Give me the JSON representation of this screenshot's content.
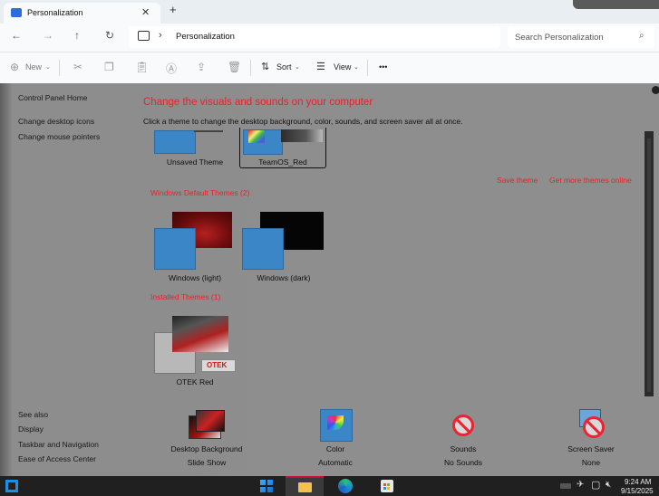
{
  "window": {
    "tab_title": "Personalization",
    "close_glyph": "✕",
    "newtab_glyph": "+"
  },
  "nav": {
    "back": "←",
    "forward": "→",
    "up": "↑",
    "refresh": "↻",
    "breadcrumb": "Personalization",
    "search_placeholder": "Search Personalization"
  },
  "commands": {
    "new": "New",
    "sort": "Sort",
    "view": "View",
    "more": "•••"
  },
  "sidebar": {
    "home": "Control Panel Home",
    "links": [
      "Change desktop icons",
      "Change mouse pointers"
    ],
    "see_also_title": "See also",
    "see_also": [
      "Display",
      "Taskbar and Navigation",
      "Ease of Access Center"
    ]
  },
  "main": {
    "heading": "Change the visuals and sounds on your computer",
    "subheading": "Click a theme to change the desktop background, color, sounds, and screen saver all at once.",
    "my_themes": [
      {
        "name": "Unsaved Theme"
      },
      {
        "name": "TeamOS_Red"
      }
    ],
    "save_theme": "Save theme",
    "get_more": "Get more themes online",
    "default_section": "Windows Default Themes (2)",
    "default_themes": [
      {
        "name": "Windows (light)"
      },
      {
        "name": "Windows (dark)"
      }
    ],
    "installed_section": "Installed Themes (1)",
    "installed_themes": [
      {
        "name": "OTEK Red",
        "logo": "OTEK"
      }
    ]
  },
  "bottom": [
    {
      "label": "Desktop Background",
      "value": "Slide Show",
      "icon": "desktop-background-icon"
    },
    {
      "label": "Color",
      "value": "Automatic",
      "icon": "color-icon"
    },
    {
      "label": "Sounds",
      "value": "No Sounds",
      "icon": "sounds-icon"
    },
    {
      "label": "Screen Saver",
      "value": "None",
      "icon": "screen-saver-icon"
    }
  ],
  "taskbar": {
    "time": "9:24 AM",
    "date": "9/15/2025"
  },
  "colors": {
    "accent_red": "#e8222a",
    "selection_blue": "#3a86c6",
    "content_bg": "#8e8e8e"
  }
}
